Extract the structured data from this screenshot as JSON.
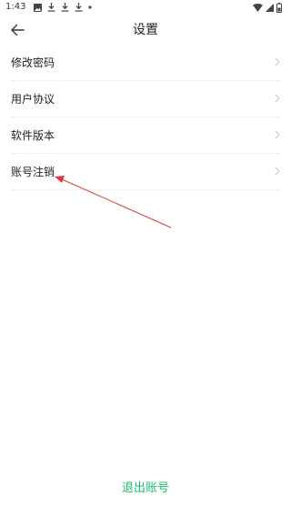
{
  "status_bar": {
    "time": "1:43",
    "left_icons": [
      "image-icon",
      "download-icon",
      "download-icon",
      "download-icon",
      "dot-icon"
    ],
    "right_icons": [
      "wifi-icon",
      "signal-icon",
      "battery-icon"
    ]
  },
  "header": {
    "back_icon": "arrow-left-icon",
    "title": "设置"
  },
  "settings": {
    "items": [
      {
        "label": "修改密码"
      },
      {
        "label": "用户协议"
      },
      {
        "label": "软件版本"
      },
      {
        "label": "账号注销"
      }
    ],
    "chevron_icon": "chevron-right-icon"
  },
  "logout": {
    "label": "退出账号",
    "color": "#19be6b"
  },
  "colors": {
    "annotation_arrow": "#e03a3a",
    "divider": "#f0f0f0",
    "chevron": "#c8c8c8"
  }
}
